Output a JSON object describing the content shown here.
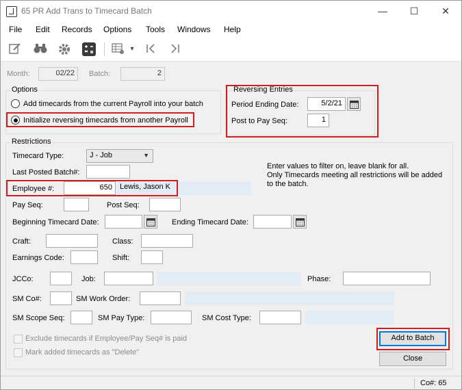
{
  "window": {
    "title": "65 PR Add Trans to Timecard Batch",
    "minimize_glyph": "—",
    "maximize_glyph": "☐",
    "close_glyph": "✕"
  },
  "menu": [
    "File",
    "Edit",
    "Records",
    "Options",
    "Tools",
    "Windows",
    "Help"
  ],
  "toolbar": {
    "icons": [
      "edit-icon",
      "binoculars-icon",
      "gear-icon",
      "calculator-icon",
      "grid-settings-icon",
      "first-record-icon",
      "last-record-icon"
    ],
    "dropdown_glyph": "▾"
  },
  "header": {
    "month_label": "Month:",
    "month_value": "02/22",
    "batch_label": "Batch:",
    "batch_value": "2"
  },
  "options": {
    "title": "Options",
    "radio_1": "Add timecards from the current Payroll into your batch",
    "radio_2": "Initialize reversing timecards from another Payroll",
    "selected": 2
  },
  "reversing": {
    "title": "Reversing Entries",
    "period_end_label": "Period Ending Date:",
    "period_end_value": "5/2/21",
    "post_seq_label": "Post to Pay Seq:",
    "post_seq_value": "1"
  },
  "restrictions": {
    "title": "Restrictions",
    "timecard_type_label": "Timecard Type:",
    "timecard_type_value": "J - Job",
    "last_posted_label": "Last Posted Batch#:",
    "last_posted_value": "",
    "info_text": "Enter values to filter on, leave blank for all.\nOnly Timecards meeting all restrictions will be added to the batch.",
    "employee_label": "Employee #:",
    "employee_value": "650",
    "employee_name": "Lewis, Jason K",
    "pay_seq_label": "Pay Seq:",
    "post_seq_label": "Post Seq:",
    "begin_date_label": "Beginning Timecard Date:",
    "end_date_label": "Ending Timecard Date:",
    "craft_label": "Craft:",
    "class_label": "Class:",
    "earnings_label": "Earnings Code:",
    "shift_label": "Shift:",
    "jcco_label": "JCCo:",
    "job_label": "Job:",
    "phase_label": "Phase:",
    "smco_label": "SM Co#:",
    "sm_work_order_label": "SM Work Order:",
    "sm_scope_label": "SM Scope Seq:",
    "sm_pay_type_label": "SM Pay Type:",
    "sm_cost_type_label": "SM Cost Type:",
    "exclude_label": "Exclude timecards if Employee/Pay Seq# is paid",
    "mark_delete_label": "Mark added timecards as \"Delete\""
  },
  "buttons": {
    "add_to_batch": "Add to Batch",
    "close": "Close"
  },
  "status": {
    "co": "Co#: 65"
  },
  "colors": {
    "highlight_red": "#d01c1c",
    "default_button_border": "#0078d7",
    "display_field_bg": "#e3ecf5"
  }
}
